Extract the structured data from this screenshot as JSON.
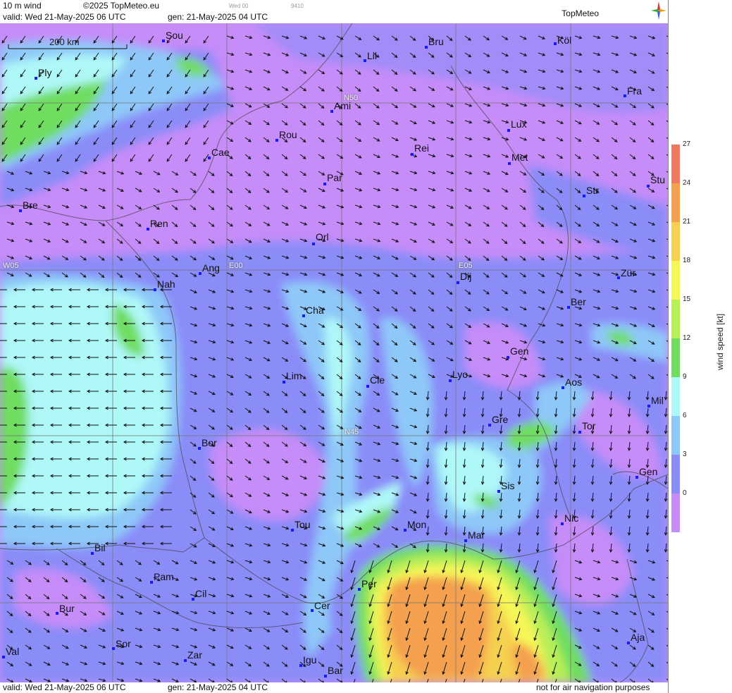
{
  "header": {
    "product": "10 m wind",
    "copyright": "©2025 TopMeteo.eu",
    "valid": "valid:  Wed  21-May-2025  06 UTC",
    "gen": "gen: 21-May-2025 04 UTC",
    "small_time": "Wed 00",
    "small_code": "9410",
    "logo": "TopMeteo"
  },
  "footer": {
    "valid": "valid:  Wed  21-May-2025  06 UTC",
    "gen": "gen: 21-May-2025 04 UTC",
    "disclaimer": "not for air navigation purposes"
  },
  "scale_bar": "200 km",
  "grid_labels": [
    "N50",
    "W05",
    "E00",
    "E05",
    "N45"
  ],
  "legend": {
    "title": "wind speed [kt]",
    "ticks": [
      "27",
      "24",
      "21",
      "18",
      "15",
      "12",
      "9",
      "6",
      "3",
      "0"
    ],
    "colors": [
      "#f07a60",
      "#f4a050",
      "#f6d050",
      "#f6f658",
      "#b8ee58",
      "#70dd60",
      "#aff8f8",
      "#8ec8f8",
      "#8a8cf8",
      "#c68cf8"
    ]
  },
  "cities": [
    {
      "name": "Sou"
    },
    {
      "name": "Bru"
    },
    {
      "name": "Köl"
    },
    {
      "name": "Ply"
    },
    {
      "name": "Lil"
    },
    {
      "name": "Fra"
    },
    {
      "name": "Ami"
    },
    {
      "name": "Lux"
    },
    {
      "name": "Rou"
    },
    {
      "name": "Cae"
    },
    {
      "name": "Rei"
    },
    {
      "name": "Met"
    },
    {
      "name": "Par"
    },
    {
      "name": "Stu"
    },
    {
      "name": "Str"
    },
    {
      "name": "Bre"
    },
    {
      "name": "Ren"
    },
    {
      "name": "Orl"
    },
    {
      "name": "Ang"
    },
    {
      "name": "Dij"
    },
    {
      "name": "Zür"
    },
    {
      "name": "Nah"
    },
    {
      "name": "Cha"
    },
    {
      "name": "Ber"
    },
    {
      "name": "Gen"
    },
    {
      "name": "Lim"
    },
    {
      "name": "Cle"
    },
    {
      "name": "Lyo"
    },
    {
      "name": "Aos"
    },
    {
      "name": "Mil"
    },
    {
      "name": "Gre"
    },
    {
      "name": "Tor"
    },
    {
      "name": "Bor"
    },
    {
      "name": "Gen"
    },
    {
      "name": "Sis"
    },
    {
      "name": "Tou"
    },
    {
      "name": "Mon"
    },
    {
      "name": "Nic"
    },
    {
      "name": "Mar"
    },
    {
      "name": "Bil"
    },
    {
      "name": "Pam"
    },
    {
      "name": "Per"
    },
    {
      "name": "Cil"
    },
    {
      "name": "Bur"
    },
    {
      "name": "Cer"
    },
    {
      "name": "Aja"
    },
    {
      "name": "Val"
    },
    {
      "name": "Sor"
    },
    {
      "name": "Zar"
    },
    {
      "name": "Igu"
    },
    {
      "name": "Bar"
    }
  ]
}
